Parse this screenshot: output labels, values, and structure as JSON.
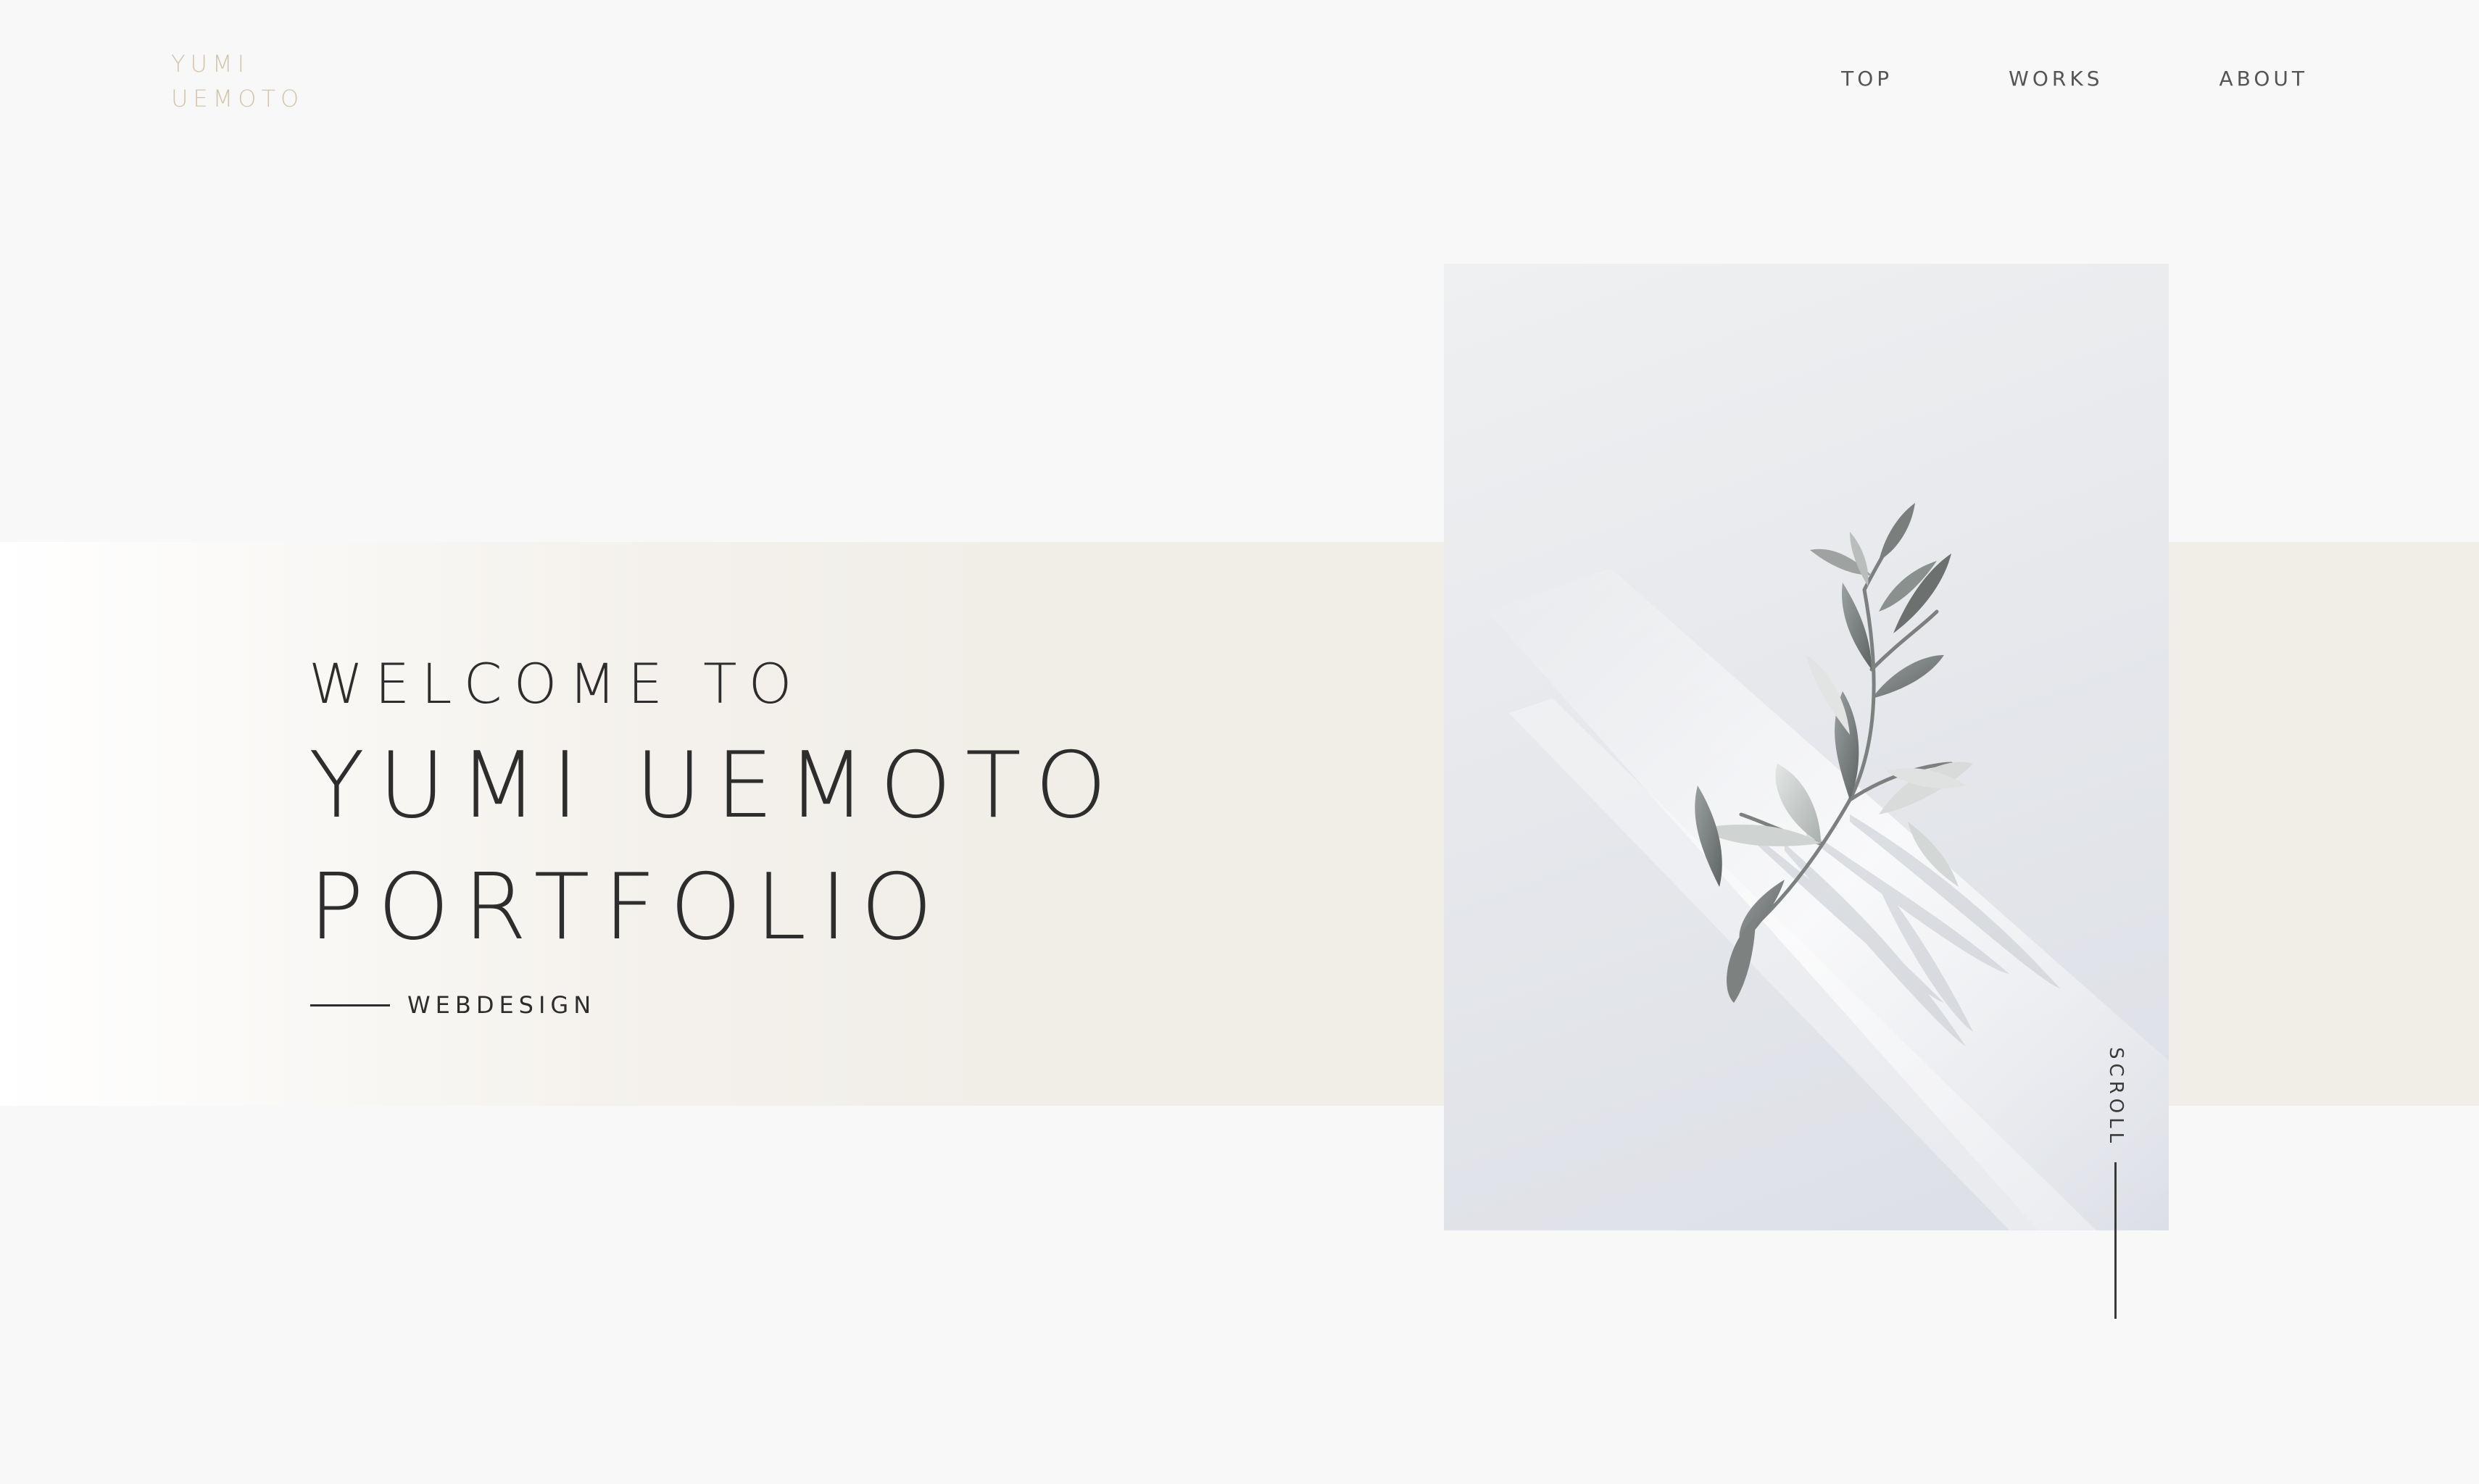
{
  "header": {
    "logo_line1": "YUMI",
    "logo_line2": "UEMOTO",
    "nav": [
      {
        "label": "TOP"
      },
      {
        "label": "WORKS"
      },
      {
        "label": "ABOUT"
      }
    ]
  },
  "hero": {
    "welcome": "WELCOME TO",
    "title_line1": "YUMI UEMOTO",
    "title_line2": "PORTFOLIO",
    "subtitle": "WEBDESIGN"
  },
  "photo": {
    "subject": "olive-branch-photo"
  },
  "scroll": {
    "label": "SCROLL"
  },
  "colors": {
    "background": "#f8f8f8",
    "band": "#f1eee8",
    "logo": "#d4c4ab",
    "text": "#2d2d2d"
  }
}
